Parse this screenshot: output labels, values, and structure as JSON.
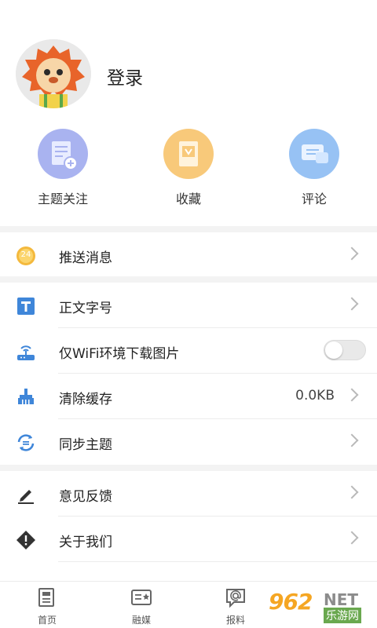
{
  "profile": {
    "login_text": "登录"
  },
  "quick_actions": [
    {
      "label": "主题关注",
      "color": "#a9b3f0",
      "icon": "topic-follow-icon"
    },
    {
      "label": "收藏",
      "color": "#f8c97a",
      "icon": "bookmark-icon"
    },
    {
      "label": "评论",
      "color": "#97c2f4",
      "icon": "comment-icon"
    }
  ],
  "settings": {
    "push": {
      "label": "推送消息",
      "badge": "24"
    },
    "font_size": {
      "label": "正文字号"
    },
    "wifi_only_images": {
      "label": "仅WiFi环境下载图片",
      "enabled": false
    },
    "clear_cache": {
      "label": "清除缓存",
      "value": "0.0KB"
    },
    "sync_theme": {
      "label": "同步主题"
    },
    "feedback": {
      "label": "意见反馈"
    },
    "about": {
      "label": "关于我们"
    }
  },
  "tabbar": [
    {
      "label": "首页",
      "icon": "news-icon"
    },
    {
      "label": "融媒",
      "icon": "media-icon"
    },
    {
      "label": "报料",
      "icon": "report-icon"
    }
  ],
  "watermark": {
    "num": "962",
    "net": "NET",
    "cn": "乐游网"
  }
}
